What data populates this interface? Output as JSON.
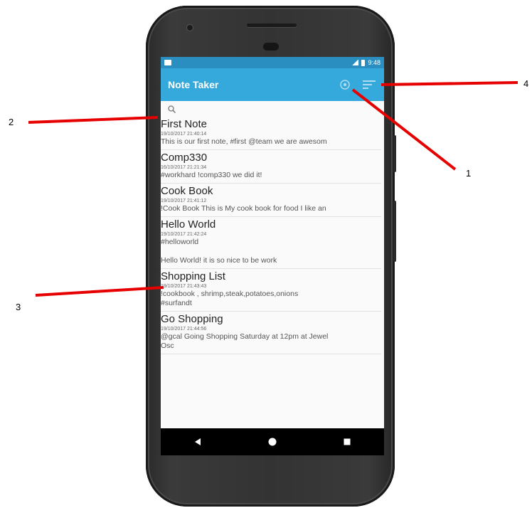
{
  "status_bar": {
    "time": "9:48"
  },
  "app_bar": {
    "title": "Note Taker",
    "icons": [
      "settings-icon",
      "sort-icon"
    ]
  },
  "search": {
    "icon": "search-icon"
  },
  "notes": [
    {
      "title": "First Note",
      "date": "19/10/2017 21:40:14",
      "body": "This is our first note, #first @team we are awesom"
    },
    {
      "title": "Comp330",
      "date": "16/10/2017 21:21:34",
      "body": "#workhard !comp330 we did it!"
    },
    {
      "title": "Cook Book",
      "date": "19/10/2017 21:41:12",
      "body": "!Cook Book This is My cook book for food I like an"
    },
    {
      "title": "Hello World",
      "date": "19/10/2017 21:42:24",
      "body": "#helloworld\n\nHello World! it is so nice to be work"
    },
    {
      "title": "Shopping List",
      "date": "19/10/2017 21:43:43",
      "body": "!cookbook , shrimp,steak,potatoes,onions\n#surfandt"
    },
    {
      "title": "Go Shopping",
      "date": "19/10/2017 21:44:56",
      "body": "@gcal Going Shopping Saturday at 12pm at Jewel\nOsc"
    }
  ],
  "nav_bar": {
    "icons": [
      "back-icon",
      "home-icon",
      "recents-icon"
    ]
  },
  "callouts": {
    "c1": "1",
    "c2": "2",
    "c3": "3",
    "c4": "4"
  },
  "colors": {
    "app_bar": "#35a9dc",
    "status_bar": "#2a8fc0",
    "arrow": "#e60000"
  }
}
